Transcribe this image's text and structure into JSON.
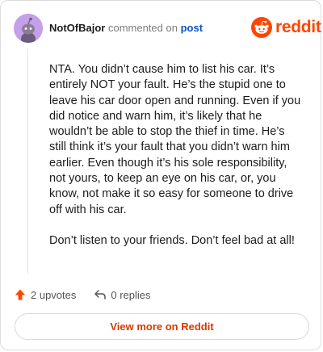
{
  "header": {
    "username": "NotOfBajor",
    "action_text": "commented on",
    "link_text": "post"
  },
  "brand": {
    "name": "reddit",
    "color": "#ff4500"
  },
  "comment": {
    "paragraphs": [
      "NTA. You didn’t cause him to list his car. It’s entirely NOT your fault. He’s the stupid one to leave his car door open and running. Even if you did notice and warn him, it’s likely that he wouldn’t be able to stop the thief in time. He’s still think it’s your fault that you didn’t warn him earlier. Even though it’s his sole responsibility, not yours, to keep an eye on his car, or, you know, not make it so easy for someone to drive off with his car.",
      "Don’t listen to your friends. Don’t feel bad at all!"
    ]
  },
  "actions": {
    "upvotes": "2 upvotes",
    "replies": "0 replies",
    "upvote_icon": "arrow-up-icon",
    "reply_icon": "reply-arrow-icon"
  },
  "footer": {
    "view_more": "View more on Reddit"
  }
}
